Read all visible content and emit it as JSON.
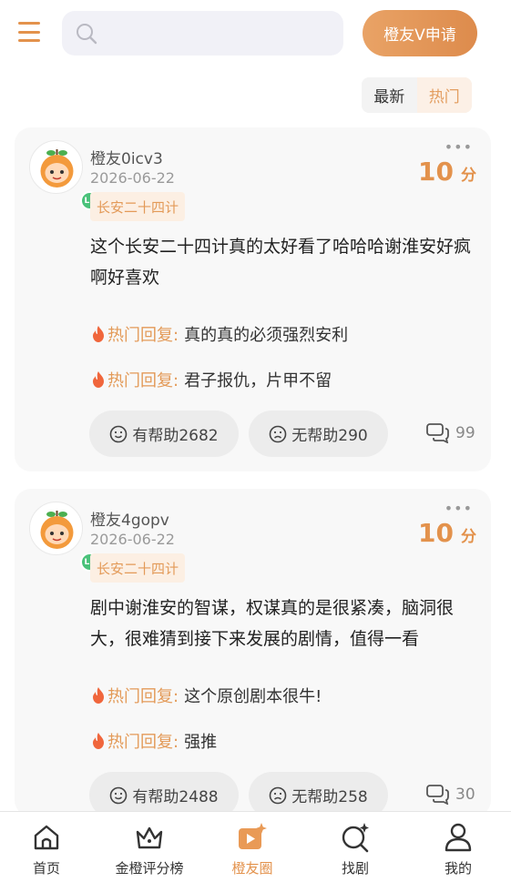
{
  "header": {
    "menu_icon": "hamburger-menu-icon",
    "search_icon": "search-icon",
    "search_placeholder": "",
    "apply_button": "橙友V申请",
    "accent_color": "#e3924c"
  },
  "sort": {
    "options": [
      "最新",
      "热门"
    ],
    "selected": "热门"
  },
  "reviews": [
    {
      "username": "橙友0icv3",
      "date": "2026-06-22",
      "level": "L2",
      "tag": "长安二十四计",
      "score": "10",
      "score_unit": "分",
      "content": "这个长安二十四计真的太好看了哈哈哈谢淮安好疯啊好喜欢",
      "hot_replies": [
        {
          "label": "热门回复:",
          "text": "真的真的必须强烈安利"
        },
        {
          "label": "热门回复:",
          "text": "君子报仇，片甲不留"
        }
      ],
      "helpful": "有帮助2682",
      "not_helpful": "无帮助290",
      "comments": "99"
    },
    {
      "username": "橙友4gopv",
      "date": "2026-06-22",
      "level": "L2",
      "tag": "长安二十四计",
      "score": "10",
      "score_unit": "分",
      "content": "剧中谢淮安的智谋，权谋真的是很紧凑，脑洞很大，很难猜到接下来发展的剧情，值得一看",
      "hot_replies": [
        {
          "label": "热门回复:",
          "text": "这个原创剧本很牛!"
        },
        {
          "label": "热门回复:",
          "text": "强推"
        }
      ],
      "helpful": "有帮助2488",
      "not_helpful": "无帮助258",
      "comments": "30"
    }
  ],
  "bottom_nav": [
    {
      "label": "首页",
      "icon": "home-icon",
      "active": false
    },
    {
      "label": "金橙评分榜",
      "icon": "crown-icon",
      "active": false
    },
    {
      "label": "橙友圈",
      "icon": "video-sparkle-icon",
      "active": true
    },
    {
      "label": "找剧",
      "icon": "search-sparkle-icon",
      "active": false
    },
    {
      "label": "我的",
      "icon": "user-icon",
      "active": false
    }
  ]
}
